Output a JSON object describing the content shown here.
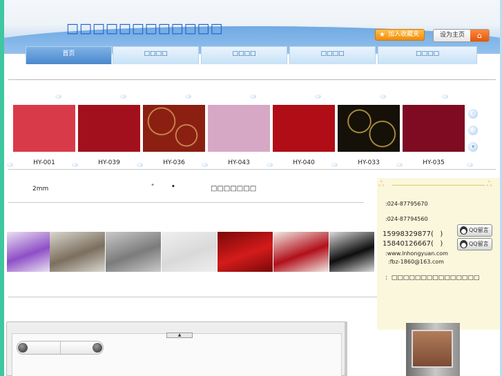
{
  "header": {
    "site_title": "□□□□□□□□□□□□",
    "fav_label": "加入收藏夹",
    "home_label": "设为主页"
  },
  "nav": {
    "items": [
      {
        "label": "首页",
        "active": true
      },
      {
        "label": "□□□□",
        "active": false
      },
      {
        "label": "□□□□",
        "active": false
      },
      {
        "label": "□□□□",
        "active": false
      },
      {
        "label": "□□□□",
        "active": false
      }
    ]
  },
  "products": [
    {
      "code": "HY-001",
      "color": "#d93a4a"
    },
    {
      "code": "HY-039",
      "color": "#a3101d"
    },
    {
      "code": "HY-036",
      "color": "#8a1f12"
    },
    {
      "code": "HY-043",
      "color": "#d7a8c5"
    },
    {
      "code": "HY-040",
      "color": "#b00d16"
    },
    {
      "code": "HY-033",
      "color": "#151008"
    },
    {
      "code": "HY-035",
      "color": "#7e0b22"
    }
  ],
  "info": {
    "size": "2mm",
    "quote": "\"",
    "dot": "•",
    "cn_text": "□□□□□□□"
  },
  "gallery": [
    {
      "color_a": "#8e4fc6",
      "color_b": "#e9e0f3"
    },
    {
      "color_a": "#7b6f5e",
      "color_b": "#d9d6cf"
    },
    {
      "color_a": "#7b7b7b",
      "color_b": "#c9c9c9"
    },
    {
      "color_a": "#d9d9d9",
      "color_b": "#efefef"
    },
    {
      "color_a": "#d41b1b",
      "color_b": "#7a0808"
    },
    {
      "color_a": "#b2101a",
      "color_b": "#f0e9e5"
    },
    {
      "color_a": "#0e0e0e",
      "color_b": "#d9d9d9"
    },
    {
      "color_a": "#c01b1b",
      "color_b": "#8f8f8f"
    }
  ],
  "contact": {
    "phone1": ":024-87795670",
    "phone2": ":024-87794560",
    "mobile1": "15998329877(   )",
    "mobile2": "15840126667(   )",
    "website": ":www.lnhongyuan.com",
    "email": ":fbz-1860@163.com",
    "address": ":  □□□□□□□□□□□□□□□",
    "qq_label": "QQ留言"
  },
  "bottom": {
    "collapse_glyph": "▲"
  }
}
